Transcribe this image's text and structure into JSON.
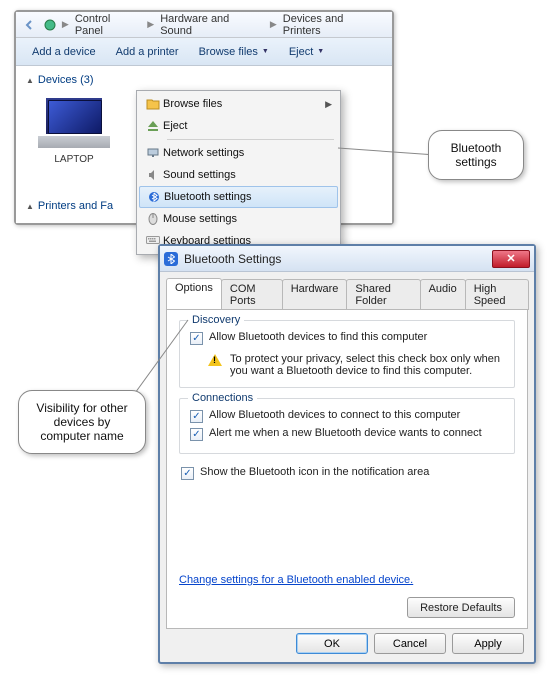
{
  "breadcrumb": {
    "seg1": "Control Panel",
    "seg2": "Hardware and Sound",
    "seg3": "Devices and Printers"
  },
  "toolbar": {
    "add_device": "Add a device",
    "add_printer": "Add a printer",
    "browse_files": "Browse files",
    "eject": "Eject"
  },
  "groups": {
    "devices": "Devices (3)",
    "printers": "Printers and Fa"
  },
  "device": {
    "name": "LAPTOP"
  },
  "ctx": {
    "browse": "Browse files",
    "eject": "Eject",
    "network": "Network settings",
    "sound": "Sound settings",
    "bluetooth": "Bluetooth settings",
    "mouse": "Mouse settings",
    "keyboard": "Keyboard settings"
  },
  "callouts": {
    "bt": "Bluetooth settings",
    "vis": "Visibility for other devices by computer name"
  },
  "dialog": {
    "title": "Bluetooth Settings",
    "tabs": {
      "options": "Options",
      "com": "COM Ports",
      "hw": "Hardware",
      "shared": "Shared Folder",
      "audio": "Audio",
      "hs": "High Speed"
    },
    "discovery": {
      "legend": "Discovery",
      "allow": "Allow Bluetooth devices to find this computer",
      "privacy": "To protect your privacy, select this check box only when you want a Bluetooth device to find this computer."
    },
    "connections": {
      "legend": "Connections",
      "allow": "Allow Bluetooth devices to connect to this computer",
      "alert": "Alert me when a new Bluetooth device wants to connect"
    },
    "show_icon": "Show the Bluetooth icon in the notification area",
    "link": "Change settings for a Bluetooth enabled device.",
    "restore": "Restore Defaults",
    "ok": "OK",
    "cancel": "Cancel",
    "apply": "Apply"
  }
}
